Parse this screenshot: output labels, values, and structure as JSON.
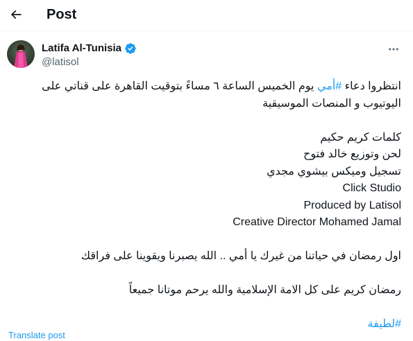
{
  "header": {
    "title": "Post",
    "back_icon": "arrow-left-icon"
  },
  "author": {
    "name": "Latifa Al-Tunisia",
    "handle": "@latisol",
    "verified_color": "#1d9bf0"
  },
  "tweet": {
    "line1_pre": "انتظروا دعاء ",
    "line1_hashtag": "#أمي",
    "line1_post": " يوم الخميس الساعة ٦ مساءً بتوقيت القاهرة على قناتي على",
    "line2": "اليوتيوب و المنصات الموسيقية",
    "credit_lyrics": "كلمات كريم حكيم",
    "credit_music": "لحن وتوزيع خالد فتوح",
    "credit_recording": "تسجيل وميكس بيشوي مجدي",
    "studio": "Click Studio",
    "producer": "Produced by Latisol",
    "director": "Creative Director Mohamed Jamal",
    "ramadan_line": "اول رمضان في حياتنا من غيرك يا أمي .. الله يصبرنا ويقوينا على فراقك",
    "blessing_line": "رمضان كريم على كل الامة الإسلامية والله يرحم موتانا جميعاً",
    "hashtag_latifa": "#لطيفة"
  },
  "translate_label": "Translate post",
  "colors": {
    "link": "#1d9bf0",
    "secondary_text": "#536471",
    "text": "#0f1419"
  }
}
